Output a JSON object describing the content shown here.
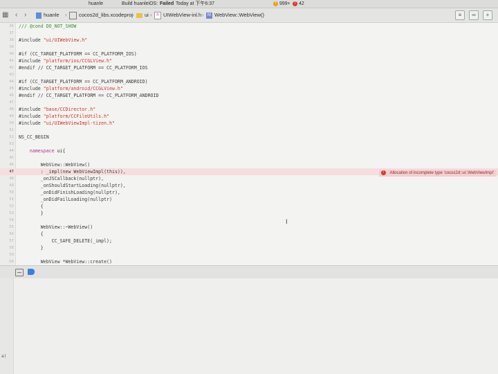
{
  "status_bar": {
    "app": "huanle",
    "build_label": "Build huanleiOS:",
    "build_result": "Failed",
    "time_label": "Today at 下午6:37",
    "warnings": "999+",
    "errors": "42"
  },
  "jump_bar": {
    "crumbs": [
      "huanle",
      "cocos2d_libs.xcodeproj",
      "ui",
      "UIWebView-inl.h",
      "WebView::WebView()"
    ]
  },
  "editor": {
    "lines": [
      {
        "n": "36",
        "text": "/// @cond DO_NOT_SHOW",
        "kind": "cmt"
      },
      {
        "n": "37",
        "text": "",
        "kind": "plain"
      },
      {
        "n": "38",
        "text": "#include \"ui/UIWebView.h\"",
        "kind": "inc"
      },
      {
        "n": "39",
        "text": "",
        "kind": "plain"
      },
      {
        "n": "40",
        "text": "#if (CC_TARGET_PLATFORM == CC_PLATFORM_IOS)",
        "kind": "plain"
      },
      {
        "n": "41",
        "text": "#include \"platform/ios/CCGLView.h\"",
        "kind": "inc"
      },
      {
        "n": "42",
        "text": "#endif // CC_TARGET_PLATFORM == CC_PLATFORM_IOS",
        "kind": "plain"
      },
      {
        "n": "43",
        "text": "",
        "kind": "plain"
      },
      {
        "n": "44",
        "text": "#if (CC_TARGET_PLATFORM == CC_PLATFORM_ANDROID)",
        "kind": "plain"
      },
      {
        "n": "45",
        "text": "#include \"platform/android/CCGLView.h\"",
        "kind": "inc"
      },
      {
        "n": "46",
        "text": "#endif // CC_TARGET_PLATFORM == CC_PLATFORM_ANDROID",
        "kind": "plain"
      },
      {
        "n": "47",
        "text": "",
        "kind": "plain"
      },
      {
        "n": "48",
        "text": "#include \"base/CCDirector.h\"",
        "kind": "inc"
      },
      {
        "n": "49",
        "text": "#include \"platform/CCFileUtils.h\"",
        "kind": "inc"
      },
      {
        "n": "50",
        "text": "#include \"ui/UIWebViewImpl-tizen.h\"",
        "kind": "inc"
      },
      {
        "n": "51",
        "text": "",
        "kind": "plain"
      },
      {
        "n": "52",
        "text": "NS_CC_BEGIN",
        "kind": "plain"
      },
      {
        "n": "53",
        "text": "",
        "kind": "plain"
      },
      {
        "n": "44",
        "text": "    namespace ui{",
        "kind": "ns"
      },
      {
        "n": "45",
        "text": "",
        "kind": "plain"
      },
      {
        "n": "46",
        "text": "        WebView::WebView()",
        "kind": "plain"
      },
      {
        "n": "47",
        "text": "        : _impl(new WebViewImpl(this)),",
        "kind": "err"
      },
      {
        "n": "48",
        "text": "        _onJSCallback(nullptr),",
        "kind": "plain"
      },
      {
        "n": "49",
        "text": "        _onShouldStartLoading(nullptr),",
        "kind": "plain"
      },
      {
        "n": "50",
        "text": "        _onDidFinishLoading(nullptr),",
        "kind": "plain"
      },
      {
        "n": "51",
        "text": "        _onDidFailLoading(nullptr)",
        "kind": "plain"
      },
      {
        "n": "52",
        "text": "        {",
        "kind": "plain"
      },
      {
        "n": "53",
        "text": "        }",
        "kind": "plain"
      },
      {
        "n": "54",
        "text": "",
        "kind": "plain"
      },
      {
        "n": "55",
        "text": "        WebView::~WebView()",
        "kind": "plain"
      },
      {
        "n": "56",
        "text": "        {",
        "kind": "plain"
      },
      {
        "n": "57",
        "text": "            CC_SAFE_DELETE(_impl);",
        "kind": "plain"
      },
      {
        "n": "58",
        "text": "        }",
        "kind": "plain"
      },
      {
        "n": "59",
        "text": "",
        "kind": "plain"
      },
      {
        "n": "60",
        "text": "        WebView *WebView::create()",
        "kind": "plain"
      }
    ],
    "error_message": "Allocation of incomplete type 'cocos2d::ui::WebViewImpl'"
  },
  "console": {
    "text": "a)"
  },
  "colors": {
    "error": "#d83a2f",
    "warning": "#e8a21a",
    "accent": "#3d7fe0"
  }
}
